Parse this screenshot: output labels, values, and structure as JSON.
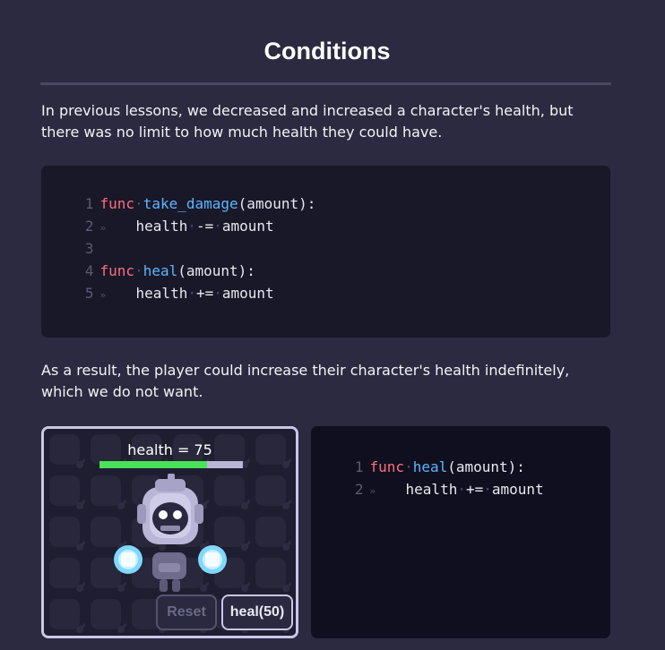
{
  "title": "Conditions",
  "paragraph1": "In previous lessons, we decreased and increased a character's health, but there was no limit to how much health they could have.",
  "paragraph2": "As a result, the player could increase their character's health indefinitely, which we do not want.",
  "code_block_1": {
    "lines": [
      {
        "n": "1",
        "kw": "func",
        "fn": "take_damage",
        "rest": "(amount):"
      },
      {
        "n": "2",
        "indent": true,
        "a": "health",
        "op": "-=",
        "b": "amount"
      },
      {
        "n": "3"
      },
      {
        "n": "4",
        "kw": "func",
        "fn": "heal",
        "rest": "(amount):"
      },
      {
        "n": "5",
        "indent": true,
        "a": "health",
        "op": "+=",
        "b": "amount"
      }
    ]
  },
  "code_block_2": {
    "lines": [
      {
        "n": "1",
        "kw": "func",
        "fn": "heal",
        "rest": "(amount):"
      },
      {
        "n": "2",
        "indent": true,
        "a": "health",
        "op": "+=",
        "b": "amount"
      }
    ]
  },
  "game": {
    "health_label": "health = 75",
    "health_fraction": 0.75,
    "reset_label": "Reset",
    "reset_enabled": false,
    "heal_label": "heal(50)"
  },
  "colors": {
    "background": "#2b2a40",
    "code_background": "#181829",
    "keyword": "#ff6d7a",
    "function": "#5cb6ff",
    "health_bar": "#49e25a"
  }
}
